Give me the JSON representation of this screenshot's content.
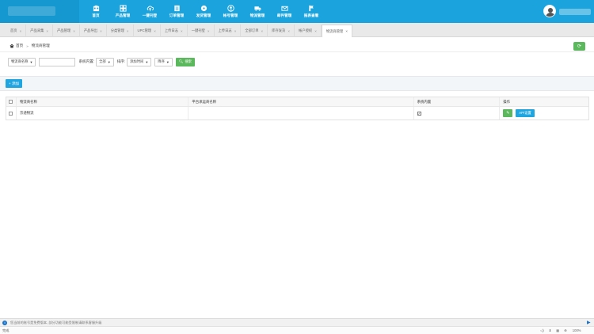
{
  "nav": {
    "items": [
      {
        "label": "首页",
        "icon": "home-icon"
      },
      {
        "label": "产品管理",
        "icon": "grid-icon"
      },
      {
        "label": "一键刊登",
        "icon": "cloud-upload-icon"
      },
      {
        "label": "订单管理",
        "icon": "list-icon"
      },
      {
        "label": "发货管理",
        "icon": "disc-icon"
      },
      {
        "label": "帐号管理",
        "icon": "user-circle-icon"
      },
      {
        "label": "物流管理",
        "icon": "truck-icon"
      },
      {
        "label": "邮件管理",
        "icon": "mail-icon"
      },
      {
        "label": "报表查看",
        "icon": "report-icon"
      }
    ]
  },
  "tabs": [
    {
      "label": "首页"
    },
    {
      "label": "产品采集"
    },
    {
      "label": "产品管理"
    },
    {
      "label": "产品导出"
    },
    {
      "label": "分类管理"
    },
    {
      "label": "UPC管理"
    },
    {
      "label": "上传日志"
    },
    {
      "label": "一键刊登"
    },
    {
      "label": "上传日志"
    },
    {
      "label": "全部订单"
    },
    {
      "label": "库存发货"
    },
    {
      "label": "帐户授权"
    },
    {
      "label": "物流商管理"
    }
  ],
  "breadcrumb": {
    "home": "首页",
    "separator": "»",
    "current": "物流商管理"
  },
  "filter": {
    "field_select": "物流商名称",
    "search_value": "",
    "builtin_label": "系统内置:",
    "builtin_select": "全部",
    "sort_label": "排序:",
    "sort_select": "添加时间",
    "order_select": "降序",
    "search_button": "搜索"
  },
  "add_button": "+ 添加",
  "table": {
    "columns": [
      "物流商名称",
      "平台承运商名称",
      "系统内置",
      "操作"
    ],
    "rows": [
      {
        "name": "京递物流",
        "platform_name": "",
        "builtin_checked": true,
        "action_label": "API设置"
      }
    ]
  },
  "status": {
    "message": "您当前的账号是免费版本, 部分功能可能受限制请联系客服升级",
    "ready": "完成",
    "zoom": "100%"
  },
  "colors": {
    "primary": "#1aa3dd",
    "success": "#5cb85c",
    "tab_bar": "#e9e9e9"
  }
}
